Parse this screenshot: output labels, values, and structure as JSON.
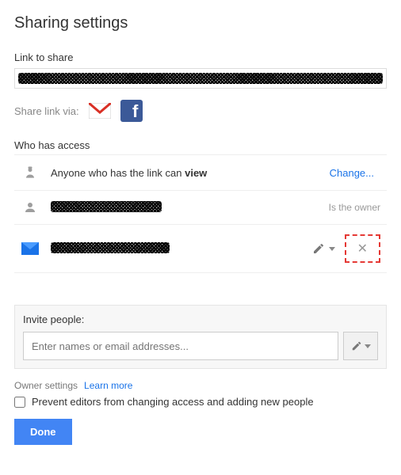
{
  "title": "Sharing settings",
  "link_label": "Link to share",
  "share_via_label": "Share link via:",
  "who_label": "Who has access",
  "access_link": {
    "prefix": "Anyone who has the link can ",
    "mode": "view",
    "change": "Change..."
  },
  "owner_right": "Is the owner",
  "invite": {
    "label": "Invite people:",
    "placeholder": "Enter names or email addresses..."
  },
  "owner_settings": {
    "label": "Owner settings",
    "learn": "Learn more",
    "checkbox": "Prevent editors from changing access and adding new people"
  },
  "done": "Done"
}
